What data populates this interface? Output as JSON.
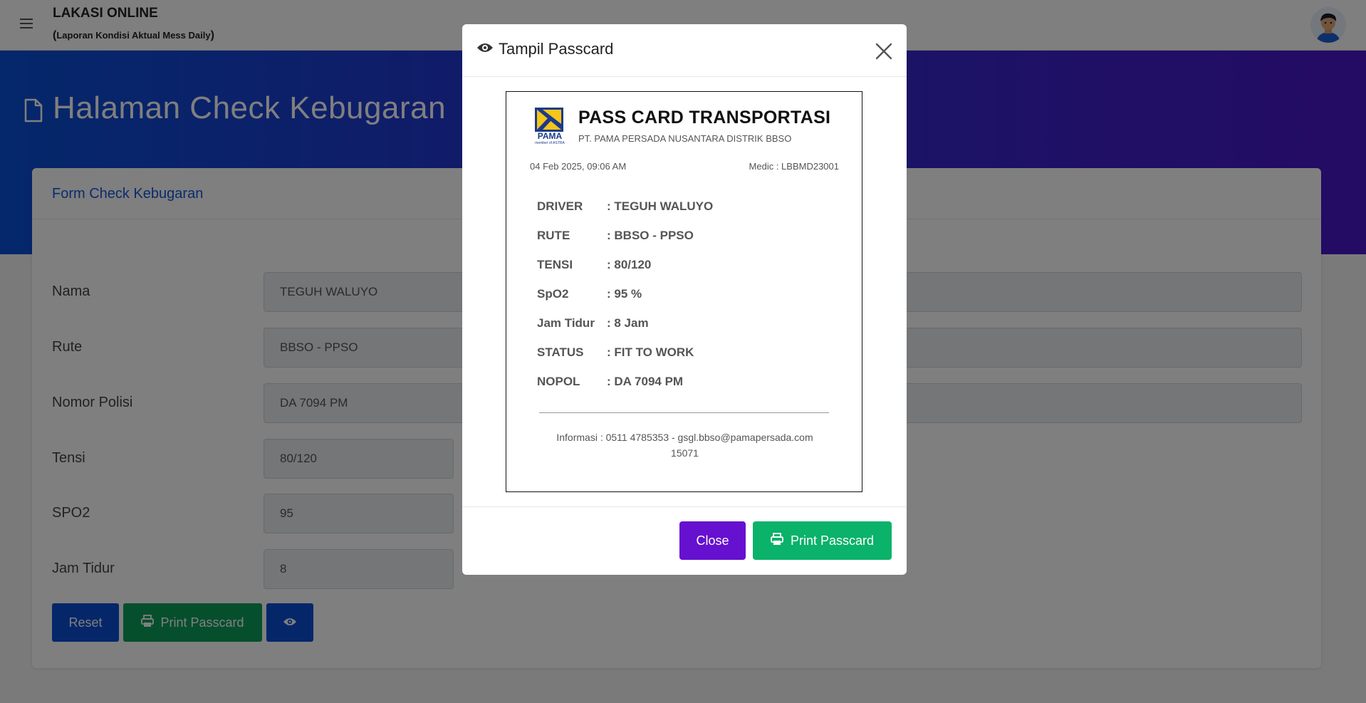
{
  "header": {
    "app_title": "LAKASI ONLINE",
    "app_subtitle_open": "(",
    "app_subtitle": "Laporan Kondisi Aktual Mess Daily",
    "app_subtitle_close": ")"
  },
  "banner": {
    "page_title": "Halaman Check Kebugaran"
  },
  "form": {
    "card_title": "Form Check Kebugaran",
    "fields": [
      {
        "label": "Nama",
        "value": "TEGUH WALUYO"
      },
      {
        "label": "Rute",
        "value": "BBSO - PPSO"
      },
      {
        "label": "Nomor Polisi",
        "value": "DA 7094 PM"
      },
      {
        "label": "Tensi",
        "value": "80/120"
      },
      {
        "label": "SPO2",
        "value": "95"
      },
      {
        "label": "Jam Tidur",
        "value": "8"
      }
    ],
    "reset_label": "Reset",
    "print_label": "Print Passcard"
  },
  "modal": {
    "title": "Tampil Passcard",
    "close_label": "Close",
    "print_label": "Print Passcard"
  },
  "passcard": {
    "logo_text": "PAMA",
    "logo_subtext": "member of ASTRA",
    "title": "PASS CARD TRANSPORTASI",
    "company": "PT. PAMA PERSADA NUSANTARA DISTRIK BBSO",
    "datetime": "04 Feb 2025, 09:06 AM",
    "medic": "Medic : LBBMD23001",
    "rows": [
      {
        "key": "DRIVER",
        "value": ": TEGUH WALUYO"
      },
      {
        "key": "RUTE",
        "value": ": BBSO - PPSO"
      },
      {
        "key": "TENSI",
        "value": ": 80/120"
      },
      {
        "key": "SpO2",
        "value": ": 95 %"
      },
      {
        "key": "Jam Tidur",
        "value": ": 8 Jam"
      },
      {
        "key": "STATUS",
        "value": ": FIT TO WORK"
      },
      {
        "key": "NOPOL",
        "value": ": DA 7094 PM"
      }
    ],
    "info_line1": "Informasi : 0511 4785353 - gsgl.bbso@pamapersada.com",
    "info_line2": "15071"
  },
  "colors": {
    "primary": "#0b4fd4",
    "success": "#0c9f5a",
    "modal_close": "#6610d0",
    "modal_print": "#0ab26a",
    "banner_start": "#0a4fd6",
    "banner_end": "#4a17c8"
  },
  "icons": [
    "menu-icon",
    "avatar",
    "document-icon",
    "printer-icon",
    "eye-icon",
    "close-icon"
  ]
}
